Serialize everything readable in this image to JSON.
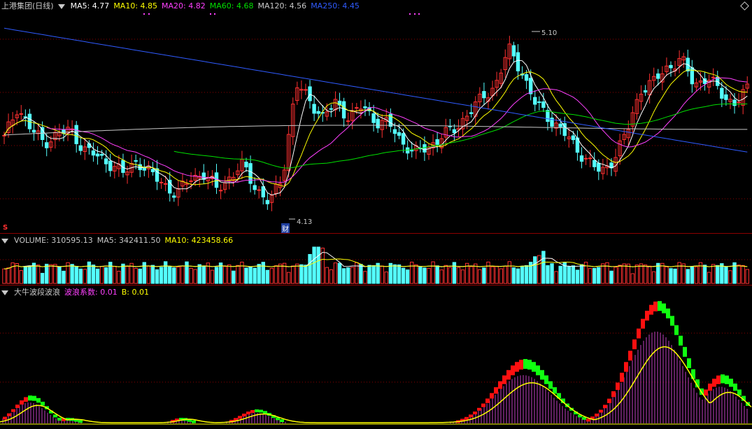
{
  "price_panel": {
    "title": "上港集团(日线)",
    "ma_items": [
      {
        "label": "MA5: 4.77",
        "color": "#ffffff"
      },
      {
        "label": "MA10: 4.85",
        "color": "#ffff00"
      },
      {
        "label": "MA20: 4.82",
        "color": "#ff40ff"
      },
      {
        "label": "MA60: 4.68",
        "color": "#00e000"
      },
      {
        "label": "MA120: 4.56",
        "color": "#c8c8c8"
      },
      {
        "label": "MA250: 4.45",
        "color": "#2f5bff"
      }
    ],
    "high_label": "5.10",
    "low_label": "4.13",
    "fin_marker": "财",
    "s_marker": "S"
  },
  "volume_panel": {
    "items": [
      {
        "label": "VOLUME: 310595.13",
        "color": "#c8c8c8"
      },
      {
        "label": "MA5: 342411.50",
        "color": "#c8c8c8"
      },
      {
        "label": "MA10: 423458.66",
        "color": "#ffff00"
      }
    ]
  },
  "indicator_panel": {
    "items": [
      {
        "label": "大牛波段波浪",
        "color": "#c8c8c8"
      },
      {
        "label": "波浪系数: 0.01",
        "color": "#ff40ff"
      },
      {
        "label": "B: 0.01",
        "color": "#ffff00"
      }
    ]
  },
  "chart_data": {
    "type": "candlestick",
    "price_range": [
      4.0,
      5.2
    ],
    "candle_up_color": "#ff3030",
    "candle_down_color": "#54ffff",
    "anchors_close": [
      4.5,
      4.68,
      4.55,
      4.48,
      4.52,
      4.55,
      4.44,
      4.4,
      4.36,
      4.3,
      4.38,
      4.3,
      4.25,
      4.18,
      4.28,
      4.3,
      4.22,
      4.28,
      4.35,
      4.22,
      4.13,
      4.3,
      4.8,
      4.72,
      4.62,
      4.7,
      4.62,
      4.68,
      4.6,
      4.58,
      4.48,
      4.42,
      4.45,
      4.52,
      4.55,
      4.65,
      4.72,
      4.8,
      5.0,
      4.88,
      4.7,
      4.62,
      4.55,
      4.45,
      4.38,
      4.3,
      4.4,
      4.55,
      4.78,
      4.82,
      4.9,
      4.95,
      4.8,
      4.85,
      4.75,
      4.7,
      4.77
    ]
  }
}
